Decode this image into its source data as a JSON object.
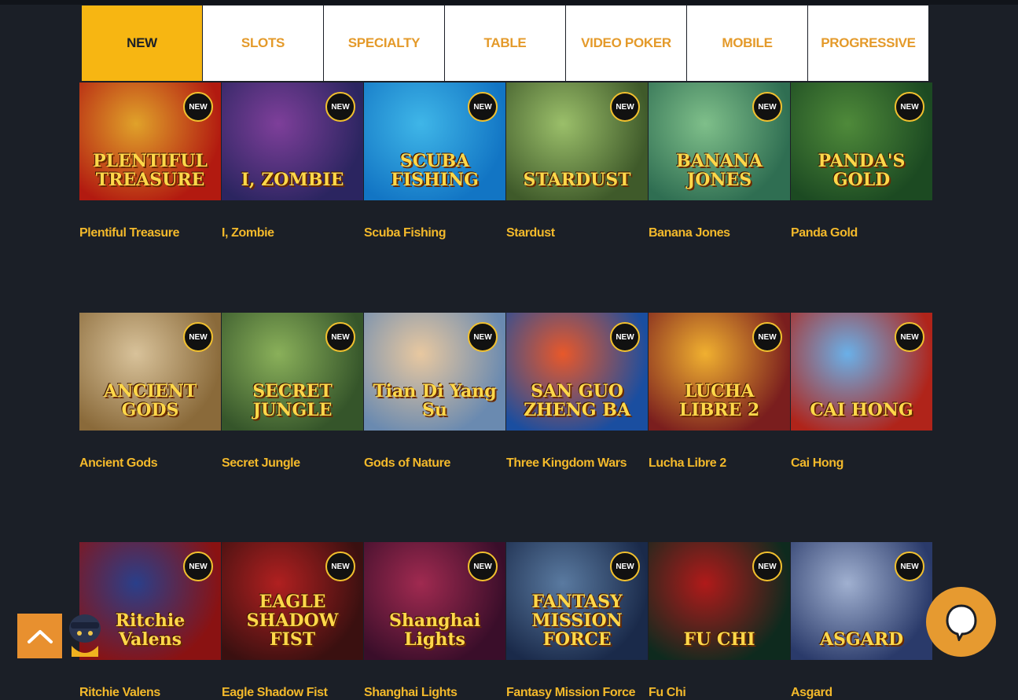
{
  "tabs": [
    {
      "label": "NEW",
      "active": true
    },
    {
      "label": "SLOTS",
      "active": false
    },
    {
      "label": "SPECIALTY",
      "active": false
    },
    {
      "label": "TABLE",
      "active": false
    },
    {
      "label": "VIDEO POKER",
      "active": false
    },
    {
      "label": "MOBILE",
      "active": false
    },
    {
      "label": "PROGRESSIVE",
      "active": false
    }
  ],
  "badge_label": "NEW",
  "games": [
    [
      {
        "title": "Plentiful Treasure",
        "logo": "PLENTIFUL TREASURE",
        "colors": [
          "#b21a10",
          "#e0a22a"
        ]
      },
      {
        "title": "I, Zombie",
        "logo": "I, ZOMBIE",
        "colors": [
          "#2b2560",
          "#7e3f9a"
        ]
      },
      {
        "title": "Scuba Fishing",
        "logo": "SCUBA FISHING",
        "colors": [
          "#1275c4",
          "#3fb6e8"
        ]
      },
      {
        "title": "Stardust",
        "logo": "STARDUST",
        "colors": [
          "#3f5a2a",
          "#9bbf6a"
        ]
      },
      {
        "title": "Banana Jones",
        "logo": "BANANA JONES",
        "colors": [
          "#2f6e52",
          "#7fbf8a"
        ]
      },
      {
        "title": "Panda Gold",
        "logo": "PANDA'S GOLD",
        "colors": [
          "#1c4a22",
          "#4f8a3a"
        ]
      }
    ],
    [
      {
        "title": "Ancient Gods",
        "logo": "ANCIENT GODS",
        "colors": [
          "#8a6a3a",
          "#d8c29a"
        ]
      },
      {
        "title": "Secret Jungle",
        "logo": "SECRET JUNGLE",
        "colors": [
          "#35552a",
          "#8ab05a"
        ]
      },
      {
        "title": "Gods of Nature",
        "logo": "Tian Di Yang Su",
        "colors": [
          "#6a8ab0",
          "#e8c8a0"
        ]
      },
      {
        "title": "Three Kingdom Wars",
        "logo": "SAN GUO ZHENG BA",
        "colors": [
          "#1a4ea0",
          "#e8582a"
        ]
      },
      {
        "title": "Lucha Libre 2",
        "logo": "LUCHA LIBRE 2",
        "colors": [
          "#7a1e1e",
          "#f0b030"
        ]
      },
      {
        "title": "Cai Hong",
        "logo": "CAI HONG",
        "colors": [
          "#b0241a",
          "#6ab0e8"
        ]
      }
    ],
    [
      {
        "title": "Ritchie Valens",
        "logo": "Ritchie Valens",
        "colors": [
          "#8a1212",
          "#2a3f8a"
        ]
      },
      {
        "title": "Eagle Shadow Fist",
        "logo": "EAGLE SHADOW FIST",
        "colors": [
          "#3a1010",
          "#b02020"
        ]
      },
      {
        "title": "Shanghai Lights",
        "logo": "Shanghai Lights",
        "colors": [
          "#3a0e2a",
          "#a02a50"
        ]
      },
      {
        "title": "Fantasy Mission Force",
        "logo": "FANTASY MISSION FORCE",
        "colors": [
          "#1a2a4a",
          "#5a7aa0"
        ]
      },
      {
        "title": "Fu Chi",
        "logo": "FU CHI",
        "colors": [
          "#0e2a1e",
          "#b01a1a"
        ]
      },
      {
        "title": "Asgard",
        "logo": "ASGARD",
        "colors": [
          "#2a3a6a",
          "#a0b0d0"
        ]
      }
    ]
  ],
  "scroll_top_icon": "chevron-up-icon",
  "chat_icon": "chat-bubble-icon",
  "colors": {
    "background": "#1b1f27",
    "tab_active": "#f7b612",
    "tab_text": "#e49a2a",
    "game_title": "#f3b92b",
    "chat_button": "#e69a30"
  }
}
